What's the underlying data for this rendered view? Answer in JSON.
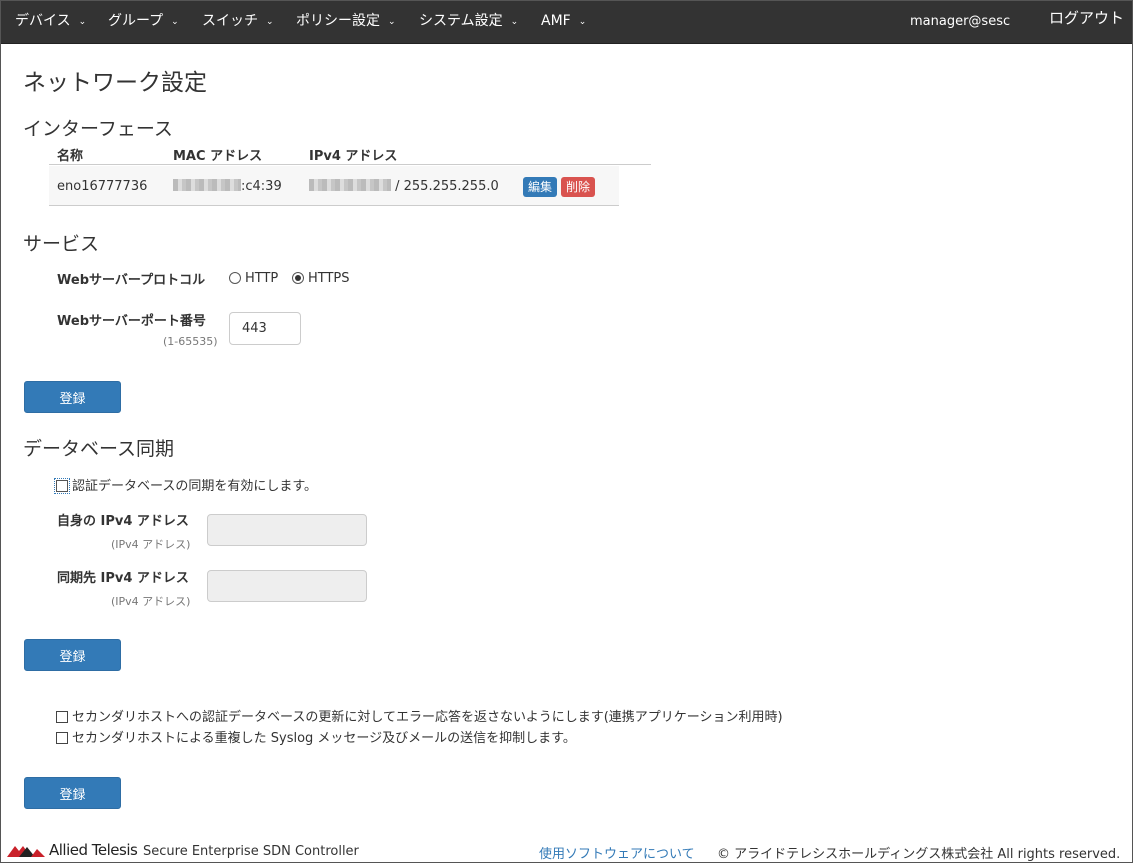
{
  "nav": {
    "items": [
      {
        "label": "デバイス"
      },
      {
        "label": "グループ"
      },
      {
        "label": "スイッチ"
      },
      {
        "label": "ポリシー設定"
      },
      {
        "label": "システム設定"
      },
      {
        "label": "AMF"
      }
    ],
    "user": "manager@sesc",
    "logout": "ログアウト"
  },
  "page": {
    "title": "ネットワーク設定"
  },
  "interface": {
    "section_title": "インターフェース",
    "headers": {
      "name": "名称",
      "mac": "MAC アドレス",
      "ipv4": "IPv4 アドレス"
    },
    "rows": [
      {
        "name": "eno16777736",
        "mac_suffix": ":c4:39",
        "netmask": " / 255.255.255.0",
        "edit": "編集",
        "delete": "削除"
      }
    ]
  },
  "service": {
    "section_title": "サービス",
    "protocol_label": "Webサーバープロトコル",
    "protocol_options": [
      "HTTP",
      "HTTPS"
    ],
    "protocol_selected": "HTTPS",
    "port_label": "Webサーバーポート番号",
    "port_hint": "(1-65535)",
    "port_value": "443",
    "submit": "登録"
  },
  "dbsync": {
    "section_title": "データベース同期",
    "enable_label": "認証データベースの同期を有効にします。",
    "self_ip_label": "自身の IPv4 アドレス",
    "self_ip_hint": "(IPv4 アドレス)",
    "peer_ip_label": "同期先 IPv4 アドレス",
    "peer_ip_hint": "(IPv4 アドレス)",
    "submit": "登録"
  },
  "secondary": {
    "option1": "セカンダリホストへの認証データベースの更新に対してエラー応答を返さないようにします(連携アプリケーション利用時)",
    "option2": "セカンダリホストによる重複した Syslog メッセージ及びメールの送信を抑制します。",
    "submit": "登録"
  },
  "footer": {
    "brand": "Allied Telesis",
    "product": "Secure Enterprise SDN Controller",
    "link": "使用ソフトウェアについて",
    "copyright": "© アライドテレシスホールディングス株式会社 All rights reserved."
  }
}
